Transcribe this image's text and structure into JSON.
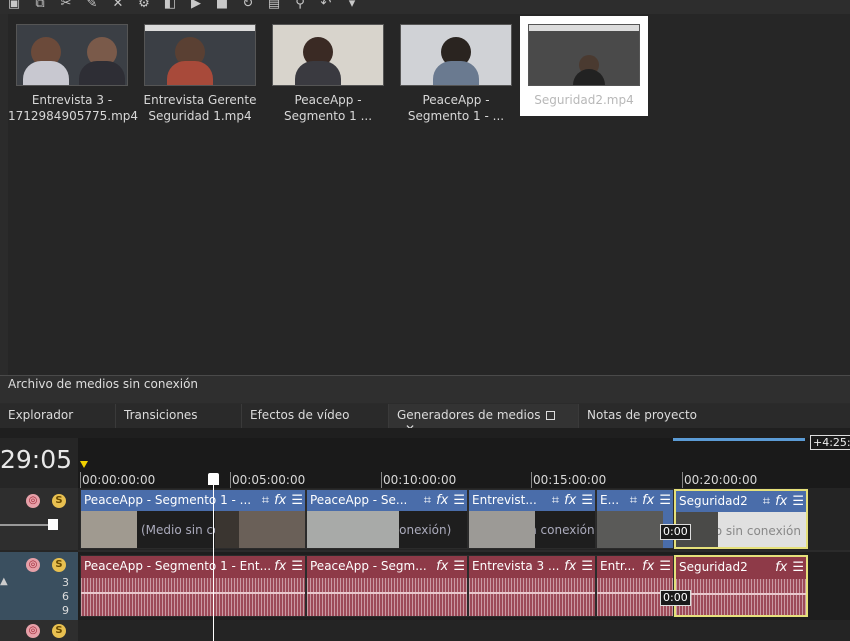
{
  "toolbar": {
    "icons": [
      "import-icon",
      "capture-icon",
      "cut-icon",
      "paint-icon",
      "delete-icon",
      "gear-icon",
      "fx-icon",
      "play-icon",
      "stop-icon",
      "run-icon",
      "screenshot-icon",
      "zoom-icon",
      "undo-icon",
      "dropdown-icon"
    ]
  },
  "media": {
    "items": [
      {
        "label": "Entrevista 3 - 1712984905775.mp4"
      },
      {
        "label": "Entrevista Gerente Seguridad 1.mp4"
      },
      {
        "label": "PeaceApp - Segmento 1 ..."
      },
      {
        "label": "PeaceApp - Segmento 1 - ..."
      },
      {
        "label": "Seguridad2.mp4"
      }
    ]
  },
  "status": {
    "text": "Archivo de medios sin conexión"
  },
  "tabs": [
    {
      "label": "Explorador"
    },
    {
      "label": "Transiciones"
    },
    {
      "label": "Efectos de vídeo"
    },
    {
      "label": "Generadores de medios"
    },
    {
      "label": "Notas de proyecto"
    }
  ],
  "timeline": {
    "timecode": "29:05",
    "range_end": "+4:25:",
    "ticks": [
      "00:00:00:00",
      "00:05:00:00",
      "00:10:00:00",
      "00:15:00:00",
      "00:20:00:00"
    ],
    "offline_text": "Medio sin conexión",
    "offline_text_short": "(Medio sin conexión)",
    "badge": "0:00",
    "db_labels": [
      "3",
      "6",
      "9"
    ]
  },
  "video_clips": [
    {
      "title": "PeaceApp - Segmento 1 - ..."
    },
    {
      "title": "PeaceApp - Se..."
    },
    {
      "title": "Entrevist..."
    },
    {
      "title": "E..."
    },
    {
      "title": "Seguridad2"
    }
  ],
  "audio_clips": [
    {
      "title": "PeaceApp - Segmento 1 - Ent..."
    },
    {
      "title": "PeaceApp - Segm..."
    },
    {
      "title": "Entrevista 3 ..."
    },
    {
      "title": "Entr..."
    },
    {
      "title": "Seguridad2"
    }
  ],
  "colors": {
    "video_clip": "#4a6daa",
    "audio_clip": "#8e3a48",
    "selection": "#e5e07a",
    "loop_bar": "#5b9bd5"
  }
}
